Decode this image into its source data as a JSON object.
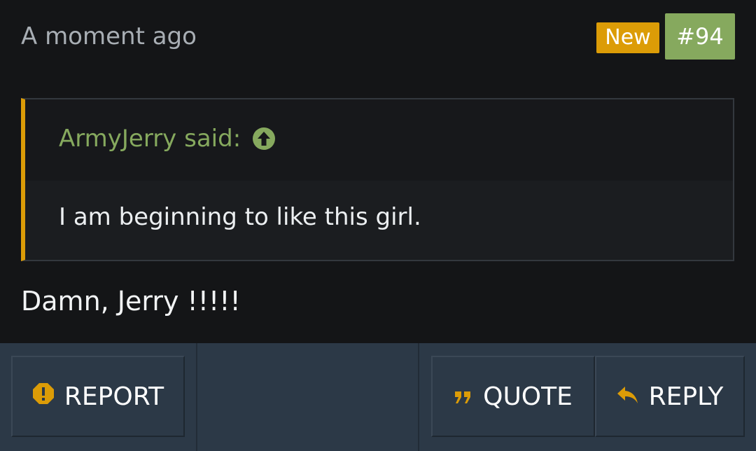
{
  "post": {
    "timestamp": "A moment ago",
    "badge_new": "New",
    "post_number": "#94",
    "quote": {
      "author_line": "ArmyJerry said:",
      "body": "I am beginning to like this girl."
    },
    "message": "Damn, Jerry !!!!!"
  },
  "actions": {
    "report": "REPORT",
    "quote": "QUOTE",
    "reply": "REPLY"
  },
  "icons": {
    "quote_jump": "arrow-up-circle-icon",
    "report": "warning-octagon-icon",
    "quote": "quote-marks-icon",
    "reply": "reply-arrow-icon"
  },
  "colors": {
    "background": "#141517",
    "accent_orange": "#dc9c07",
    "accent_green": "#86a95e",
    "footer": "#2c3947",
    "timestamp_gray": "#a8aeb4"
  }
}
